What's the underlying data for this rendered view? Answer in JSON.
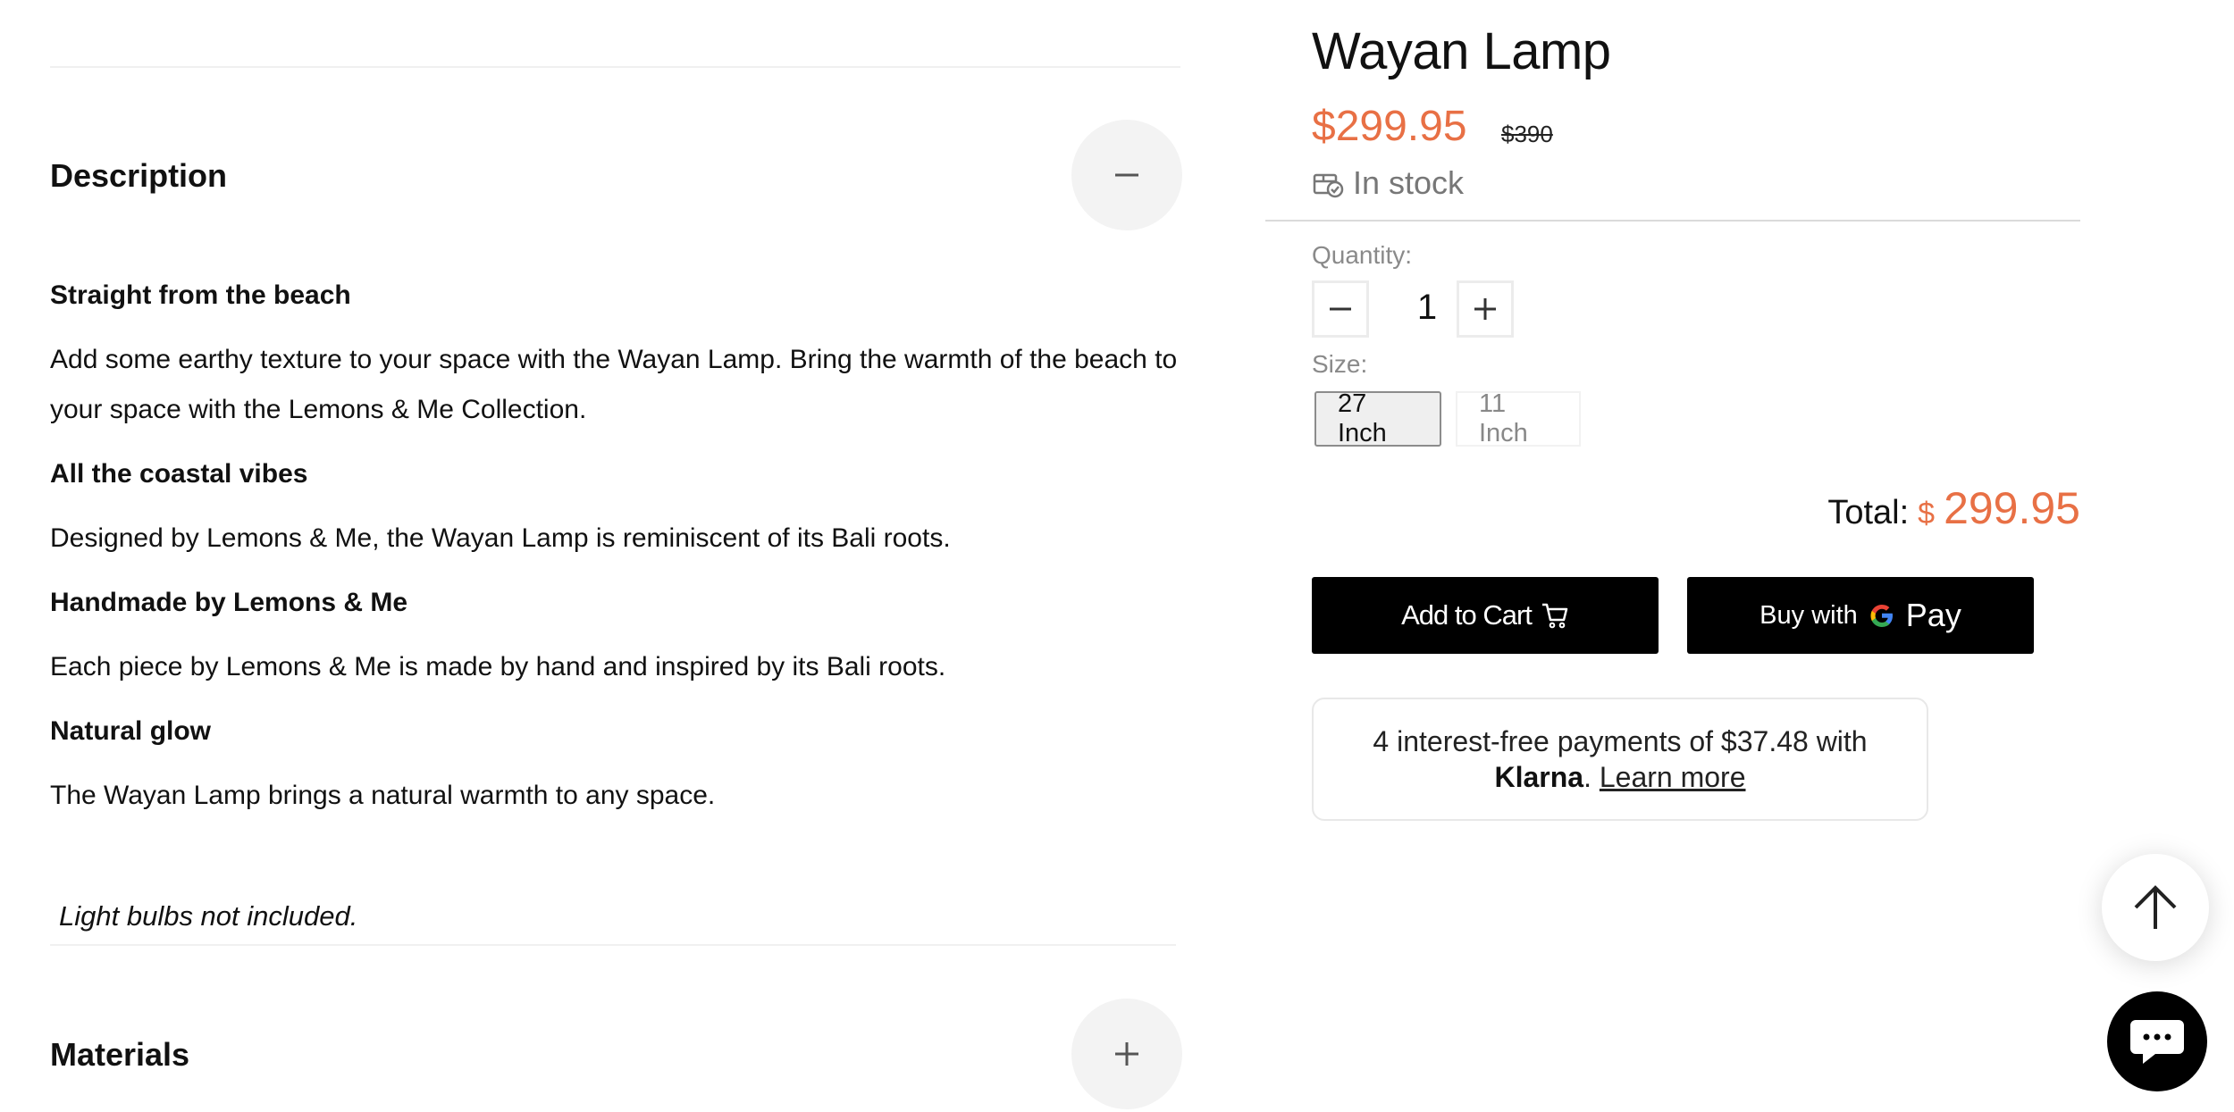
{
  "description_section": {
    "title": "Description",
    "toggle_icon": "minus-icon",
    "blocks": [
      {
        "heading": "Straight from the beach",
        "text": "Add some earthy texture to your space with the Wayan Lamp. Bring the warmth of the beach to your space with the Lemons & Me Collection."
      },
      {
        "heading": "All the coastal vibes",
        "text": "Designed by Lemons & Me, the Wayan Lamp is reminiscent of its Bali roots."
      },
      {
        "heading": "Handmade by Lemons & Me",
        "text": "Each piece by Lemons & Me is made by hand and inspired by its Bali roots."
      },
      {
        "heading": "Natural glow",
        "text": "The Wayan Lamp brings a natural warmth to any space."
      }
    ],
    "note": "Light bulbs not included."
  },
  "materials_section": {
    "title": "Materials",
    "toggle_icon": "plus-icon"
  },
  "product": {
    "title": "Wayan Lamp",
    "price": "$299.95",
    "compare_price": "$390",
    "stock": "In stock",
    "stock_icon": "package-check-icon",
    "quantity_label": "Quantity:",
    "quantity": "1",
    "size_label": "Size:",
    "sizes": [
      "27 Inch",
      "11 Inch"
    ],
    "selected_size": "27 Inch",
    "total_label": "Total:",
    "total_currency": "$",
    "total_value": "299.95",
    "add_to_cart": "Add to Cart",
    "buy_with": "Buy with",
    "gpay": "Pay",
    "klarna": {
      "line1": "4 interest-free payments of $37.48 with",
      "brand": "Klarna",
      "dot": ".",
      "link": "Learn more"
    }
  },
  "colors": {
    "accent": "#e87045",
    "button_bg": "#000000",
    "muted_text": "#8a8a8a"
  },
  "floating": {
    "scroll_top_icon": "arrow-up-icon",
    "chat_icon": "chat-bubble-icon"
  }
}
